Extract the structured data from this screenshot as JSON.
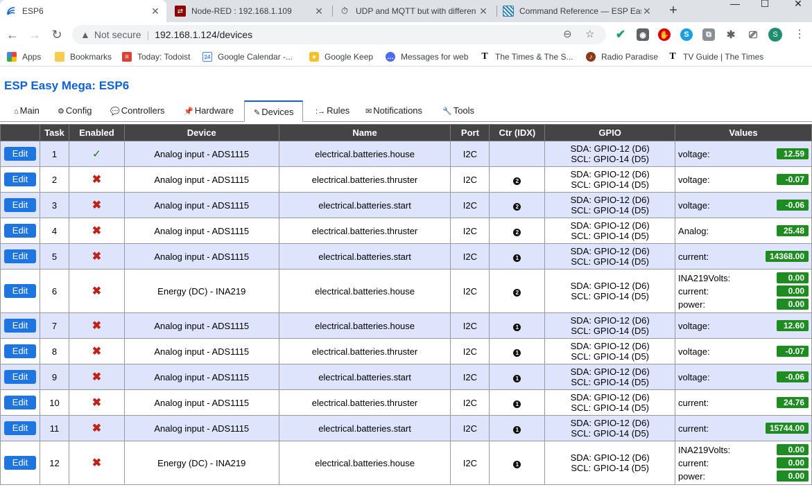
{
  "browser": {
    "tabs": [
      {
        "title": "ESP6",
        "active": true
      },
      {
        "title": "Node-RED : 192.168.1.109",
        "active": false
      },
      {
        "title": "UDP and MQTT but with differen",
        "active": false
      },
      {
        "title": "Command Reference — ESP Eas",
        "active": false
      }
    ],
    "new_tab_label": "+",
    "window_controls": {
      "minimize": "—",
      "maximize": "☐",
      "close": "✕"
    },
    "address": {
      "security_label": "Not secure",
      "url": "192.168.1.124/devices"
    },
    "profile_initial": "S",
    "bookmarks": [
      {
        "label": "Apps",
        "icon": "apps-grid-icon"
      },
      {
        "label": "Bookmarks",
        "icon": "folder-icon"
      },
      {
        "label": "Today: Todoist",
        "icon": "todoist-icon"
      },
      {
        "label": "Google Calendar -...",
        "icon": "calendar-icon"
      },
      {
        "label": "Google Keep",
        "icon": "keep-icon"
      },
      {
        "label": "Messages for web",
        "icon": "messages-icon"
      },
      {
        "label": "The Times & The S...",
        "icon": "times-icon"
      },
      {
        "label": "Radio Paradise",
        "icon": "radio-paradise-icon"
      },
      {
        "label": "TV Guide | The Times",
        "icon": "times-icon"
      }
    ]
  },
  "page": {
    "title": "ESP Easy Mega: ESP6",
    "nav": [
      {
        "label": "Main",
        "icon": "⌂"
      },
      {
        "label": "Config",
        "icon": "⚙"
      },
      {
        "label": "Controllers",
        "icon": "💬"
      },
      {
        "label": "Hardware",
        "icon": "📌"
      },
      {
        "label": "Devices",
        "icon": "✎"
      },
      {
        "label": "Rules",
        "icon": ":→"
      },
      {
        "label": "Notifications",
        "icon": "✉"
      },
      {
        "label": "Tools",
        "icon": "🔧"
      }
    ],
    "columns": [
      "",
      "Task",
      "Enabled",
      "Device",
      "Name",
      "Port",
      "Ctr (IDX)",
      "GPIO",
      "Values"
    ],
    "edit_label": "Edit",
    "rows": [
      {
        "task": "1",
        "enabled": true,
        "device": "Analog input - ADS1115",
        "name": "electrical.batteries.house",
        "port": "I2C",
        "ctr": "",
        "gpio": [
          "SDA: GPIO-12 (D6)",
          "SCL: GPIO-14 (D5)"
        ],
        "values": [
          {
            "label": "voltage:",
            "value": "12.59"
          }
        ]
      },
      {
        "task": "2",
        "enabled": false,
        "device": "Analog input - ADS1115",
        "name": "electrical.batteries.thruster",
        "port": "I2C",
        "ctr": "2",
        "gpio": [
          "SDA: GPIO-12 (D6)",
          "SCL: GPIO-14 (D5)"
        ],
        "values": [
          {
            "label": "voltage:",
            "value": "-0.07"
          }
        ]
      },
      {
        "task": "3",
        "enabled": false,
        "device": "Analog input - ADS1115",
        "name": "electrical.batteries.start",
        "port": "I2C",
        "ctr": "2",
        "gpio": [
          "SDA: GPIO-12 (D6)",
          "SCL: GPIO-14 (D5)"
        ],
        "values": [
          {
            "label": "voltage:",
            "value": "-0.06"
          }
        ]
      },
      {
        "task": "4",
        "enabled": false,
        "device": "Analog input - ADS1115",
        "name": "electrical.batteries.thruster",
        "port": "I2C",
        "ctr": "2",
        "gpio": [
          "SDA: GPIO-12 (D6)",
          "SCL: GPIO-14 (D5)"
        ],
        "values": [
          {
            "label": "Analog:",
            "value": "25.48"
          }
        ]
      },
      {
        "task": "5",
        "enabled": false,
        "device": "Analog input - ADS1115",
        "name": "electrical.batteries.start",
        "port": "I2C",
        "ctr": "1",
        "gpio": [
          "SDA: GPIO-12 (D6)",
          "SCL: GPIO-14 (D5)"
        ],
        "values": [
          {
            "label": "current:",
            "value": "14368.00"
          }
        ]
      },
      {
        "task": "6",
        "enabled": false,
        "device": "Energy (DC) - INA219",
        "name": "electrical.batteries.house",
        "port": "I2C",
        "ctr": "2",
        "gpio": [
          "SDA: GPIO-12 (D6)",
          "SCL: GPIO-14 (D5)"
        ],
        "values": [
          {
            "label": "INA219Volts:",
            "value": "0.00"
          },
          {
            "label": "current:",
            "value": "0.00"
          },
          {
            "label": "power:",
            "value": "0.00"
          }
        ]
      },
      {
        "task": "7",
        "enabled": false,
        "device": "Analog input - ADS1115",
        "name": "electrical.batteries.house",
        "port": "I2C",
        "ctr": "1",
        "gpio": [
          "SDA: GPIO-12 (D6)",
          "SCL: GPIO-14 (D5)"
        ],
        "values": [
          {
            "label": "voltage:",
            "value": "12.60"
          }
        ]
      },
      {
        "task": "8",
        "enabled": false,
        "device": "Analog input - ADS1115",
        "name": "electrical.batteries.thruster",
        "port": "I2C",
        "ctr": "1",
        "gpio": [
          "SDA: GPIO-12 (D6)",
          "SCL: GPIO-14 (D5)"
        ],
        "values": [
          {
            "label": "voltage:",
            "value": "-0.07"
          }
        ]
      },
      {
        "task": "9",
        "enabled": false,
        "device": "Analog input - ADS1115",
        "name": "electrical.batteries.start",
        "port": "I2C",
        "ctr": "1",
        "gpio": [
          "SDA: GPIO-12 (D6)",
          "SCL: GPIO-14 (D5)"
        ],
        "values": [
          {
            "label": "voltage:",
            "value": "-0.06"
          }
        ]
      },
      {
        "task": "10",
        "enabled": false,
        "device": "Analog input - ADS1115",
        "name": "electrical.batteries.thruster",
        "port": "I2C",
        "ctr": "1",
        "gpio": [
          "SDA: GPIO-12 (D6)",
          "SCL: GPIO-14 (D5)"
        ],
        "values": [
          {
            "label": "current:",
            "value": "24.76"
          }
        ]
      },
      {
        "task": "11",
        "enabled": false,
        "device": "Analog input - ADS1115",
        "name": "electrical.batteries.start",
        "port": "I2C",
        "ctr": "1",
        "gpio": [
          "SDA: GPIO-12 (D6)",
          "SCL: GPIO-14 (D5)"
        ],
        "values": [
          {
            "label": "current:",
            "value": "15744.00"
          }
        ]
      },
      {
        "task": "12",
        "enabled": false,
        "device": "Energy (DC) - INA219",
        "name": "electrical.batteries.house",
        "port": "I2C",
        "ctr": "1",
        "gpio": [
          "SDA: GPIO-12 (D6)",
          "SCL: GPIO-14 (D5)"
        ],
        "values": [
          {
            "label": "INA219Volts:",
            "value": "0.00"
          },
          {
            "label": "current:",
            "value": "0.00"
          },
          {
            "label": "power:",
            "value": "0.00"
          }
        ]
      }
    ]
  },
  "colors": {
    "accent": "#0f62d6",
    "edit_button": "#1e75e0",
    "value_badge": "#1e8c21",
    "row_alt": "#dde4fb",
    "header_bg": "#444444"
  }
}
